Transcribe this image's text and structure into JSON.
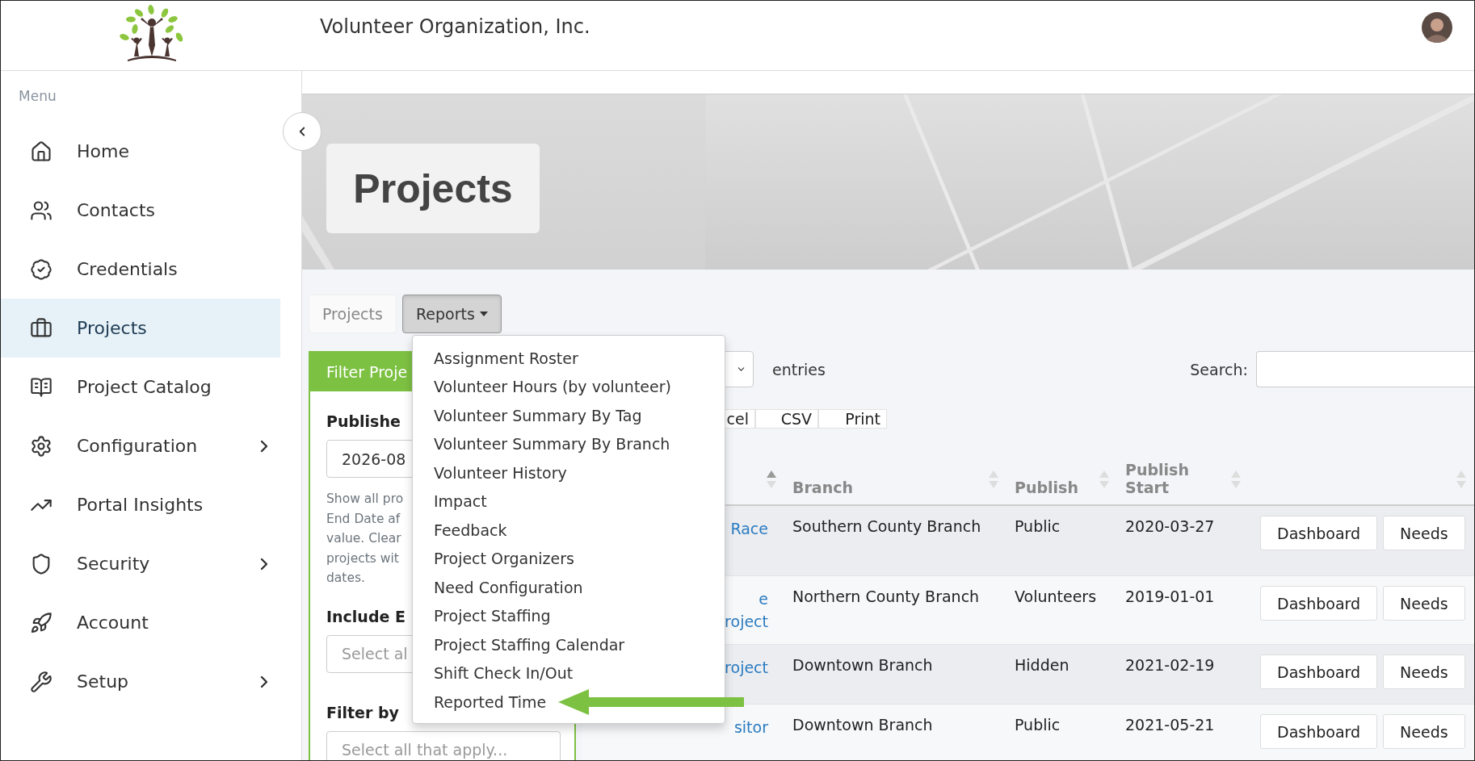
{
  "header": {
    "org_name": "Volunteer Organization, Inc."
  },
  "sidebar": {
    "heading": "Menu",
    "items": [
      {
        "kind": "home",
        "label": "Home",
        "selected": false,
        "has_submenu": false
      },
      {
        "kind": "people",
        "label": "Contacts",
        "selected": false,
        "has_submenu": false
      },
      {
        "kind": "badge",
        "label": "Credentials",
        "selected": false,
        "has_submenu": false
      },
      {
        "kind": "briefcase",
        "label": "Projects",
        "selected": true,
        "has_submenu": false
      },
      {
        "kind": "book",
        "label": "Project Catalog",
        "selected": false,
        "has_submenu": false
      },
      {
        "kind": "gear",
        "label": "Configuration",
        "selected": false,
        "has_submenu": true
      },
      {
        "kind": "insights",
        "label": "Portal Insights",
        "selected": false,
        "has_submenu": false
      },
      {
        "kind": "shield",
        "label": "Security",
        "selected": false,
        "has_submenu": true
      },
      {
        "kind": "rocket",
        "label": "Account",
        "selected": false,
        "has_submenu": false
      },
      {
        "kind": "wrench",
        "label": "Setup",
        "selected": false,
        "has_submenu": true
      }
    ]
  },
  "page_title": "Projects",
  "tabs": [
    {
      "kind": "tab",
      "label": "Projects",
      "selected": false
    },
    {
      "kind": "dropdown",
      "label": "Reports",
      "selected": true
    }
  ],
  "reports_menu": {
    "items": [
      {
        "label": "Assignment Roster",
        "callout": false
      },
      {
        "label": "Volunteer Hours (by volunteer)",
        "callout": false
      },
      {
        "label": "Volunteer Summary By Tag",
        "callout": false
      },
      {
        "label": "Volunteer Summary By Branch",
        "callout": false
      },
      {
        "label": "Volunteer History",
        "callout": false
      },
      {
        "label": "Impact",
        "callout": false
      },
      {
        "label": "Feedback",
        "callout": false
      },
      {
        "label": "Project Organizers",
        "callout": false
      },
      {
        "label": "Need Configuration",
        "callout": false
      },
      {
        "label": "Project Staffing",
        "callout": false
      },
      {
        "label": "Project Staffing Calendar",
        "callout": false
      },
      {
        "label": "Shift Check In/Out",
        "callout": false
      },
      {
        "label": "Reported Time",
        "callout": true
      }
    ]
  },
  "filter_panel": {
    "title": "Filter Proje",
    "fields": [
      {
        "label": "Publishe",
        "value": "2026-08",
        "help_lines": [
          "Show all pro",
          "End Date af",
          "value. Clear",
          "projects wit",
          "dates."
        ]
      },
      {
        "label": "Include E",
        "placeholder": "Select al"
      },
      {
        "label": "Filter by",
        "placeholder": "Select all that apply..."
      }
    ]
  },
  "table_controls": {
    "entries_label": "entries",
    "search_label": "Search:"
  },
  "export_buttons": [
    "cel",
    "CSV",
    "Print"
  ],
  "table": {
    "columns": [
      {
        "sorted_ascending": true
      },
      {
        "label": "Branch",
        "sorted_ascending": false
      },
      {
        "label": "Publish",
        "sorted_ascending": false
      },
      {
        "label": "Publish Start",
        "sorted_ascending": false
      },
      {
        "sorted_ascending": false
      }
    ],
    "rows": [
      {
        "name": [
          "Race"
        ],
        "branch": "Southern County Branch",
        "publish": "Public",
        "publish_start": "2020-03-27",
        "actions": [
          "Dashboard",
          "Needs"
        ]
      },
      {
        "name": [
          "e",
          "roject"
        ],
        "branch": "Northern County Branch",
        "publish": "Volunteers",
        "publish_start": "2019-01-01",
        "actions": [
          "Dashboard",
          "Needs"
        ]
      },
      {
        "name": [
          "roject"
        ],
        "branch": "Downtown Branch",
        "publish": "Hidden",
        "publish_start": "2021-02-19",
        "actions": [
          "Dashboard",
          "Needs"
        ]
      },
      {
        "name": [
          "sitor"
        ],
        "branch": "Downtown Branch",
        "publish": "Public",
        "publish_start": "2021-05-21",
        "actions": [
          "Dashboard",
          "Needs"
        ]
      }
    ]
  }
}
